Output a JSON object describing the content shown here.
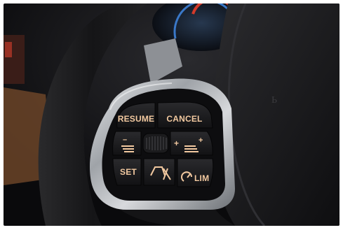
{
  "buttons": {
    "resume": "RESUME",
    "cancel": "CANCEL",
    "set": "SET",
    "lim": "LIM",
    "plus": "+",
    "minus": "–"
  },
  "colors": {
    "backlight": "#f2c9a0",
    "button_face": "#1a1a1c",
    "chrome_trim": "#b9bcc0",
    "leather": "#1c1c1e",
    "cluster_red": "#d23a2a",
    "cluster_blue": "#3a78c8"
  },
  "icons": [
    "distance-icon",
    "speed-limit-icon",
    "speed-up-icon",
    "speed-down-icon",
    "thumbwheel-icon"
  ]
}
